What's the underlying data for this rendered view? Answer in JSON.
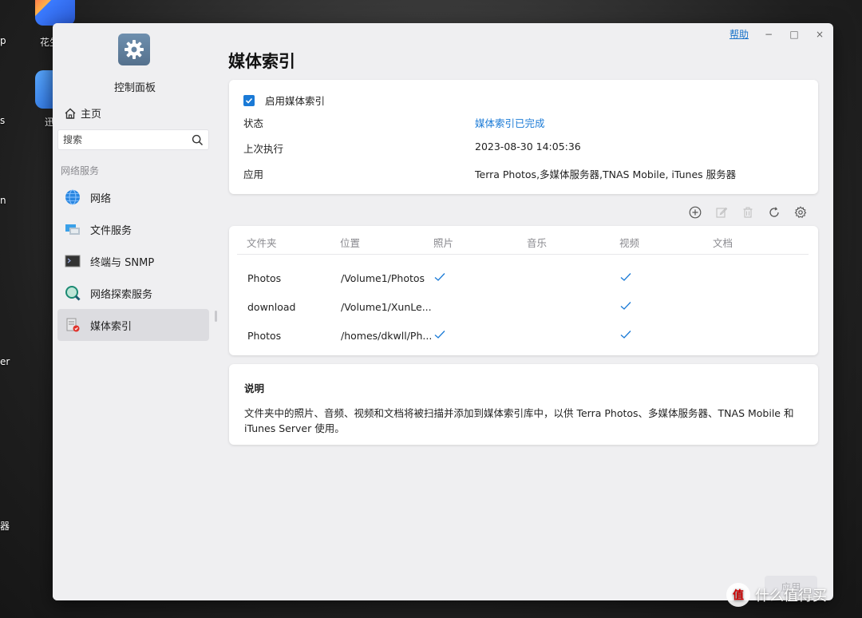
{
  "desktop": {
    "labels": [
      "p",
      "花生",
      "s",
      "迅",
      "n",
      "er",
      "器"
    ]
  },
  "window": {
    "help": "帮助",
    "minimize": "−",
    "maximize": "□",
    "close": "×"
  },
  "sidebar": {
    "app_title": "控制面板",
    "home": "主页",
    "search_placeholder": "搜索",
    "section": "网络服务",
    "items": [
      {
        "label": "网络"
      },
      {
        "label": "文件服务"
      },
      {
        "label": "终端与 SNMP"
      },
      {
        "label": "网络探索服务"
      },
      {
        "label": "媒体索引"
      }
    ]
  },
  "main": {
    "title": "媒体索引",
    "enable_label": "启用媒体索引",
    "enabled": true,
    "status_label": "状态",
    "status_value": "媒体索引已完成",
    "last_run_label": "上次执行",
    "last_run_value": "2023-08-30 14:05:36",
    "apps_label": "应用",
    "apps_value": "Terra Photos,多媒体服务器,TNAS Mobile, iTunes 服务器",
    "table": {
      "columns": [
        "文件夹",
        "位置",
        "照片",
        "音乐",
        "视频",
        "文档"
      ],
      "rows": [
        {
          "folder": "Photos",
          "location": "/Volume1/Photos",
          "photo": true,
          "music": false,
          "video": true,
          "doc": false
        },
        {
          "folder": "download",
          "location": "/Volume1/XunLe...",
          "photo": false,
          "music": false,
          "video": true,
          "doc": false
        },
        {
          "folder": "Photos",
          "location": "/homes/dkwll/Ph...",
          "photo": true,
          "music": false,
          "video": true,
          "doc": false
        }
      ]
    },
    "desc_title": "说明",
    "desc_body": "文件夹中的照片、音频、视频和文档将被扫描并添加到媒体索引库中，以供 Terra Photos、多媒体服务器、TNAS Mobile 和 iTunes Server 使用。",
    "apply": "应用"
  },
  "watermark": {
    "icon": "值",
    "text": "什么值得买"
  },
  "colors": {
    "accent": "#1a7ad6",
    "window_bg": "#efeff1",
    "active_item": "#dcdce0"
  }
}
